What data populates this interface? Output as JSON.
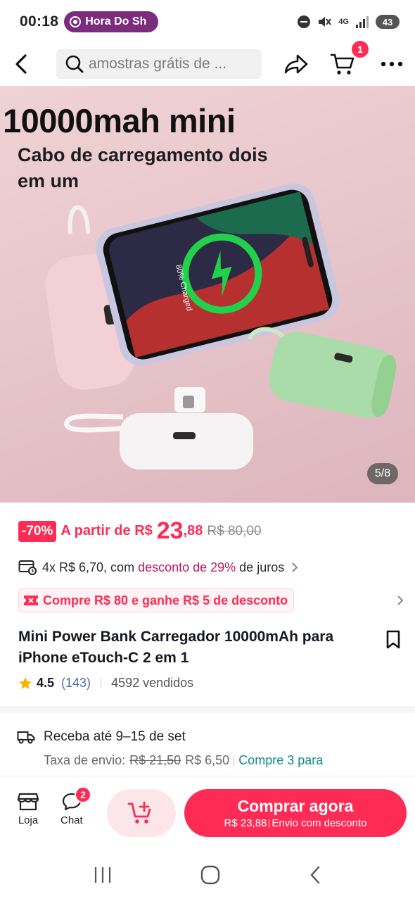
{
  "status_bar": {
    "time": "00:18",
    "live_pill": "Hora Do Sh",
    "network": "4G",
    "battery": "43"
  },
  "top_nav": {
    "search_placeholder": "amostras grátis de ...",
    "cart_count": "1"
  },
  "hero": {
    "title": "10000mah mini",
    "subtitle": "Cabo de carregamento dois em um",
    "phone_screen_text": "80% Charged",
    "counter": "5/8"
  },
  "price": {
    "discount": "-70%",
    "from_label": "A partir de R$",
    "value_int": "23",
    "value_dec": ",88",
    "old_price": "R$ 80,00"
  },
  "installment": {
    "prefix": "4x R$ 6,70, com",
    "highlight": "desconto de 29%",
    "suffix": "de juros"
  },
  "promo": {
    "label": "Compre R$ 80 e ganhe R$ 5 de desconto"
  },
  "product": {
    "title": "Mini Power Bank Carregador 10000mAh para iPhone eTouch-C 2 em 1",
    "rating": "4.5",
    "reviews": "(143)",
    "sold": "4592 vendidos"
  },
  "delivery": {
    "text": "Receba até 9–15 de set",
    "shipping_label": "Taxa de envio:",
    "shipping_old": "R$ 21,50",
    "shipping_new": "R$ 6,50",
    "shipping_promo": "Compre 3 para"
  },
  "bottom_bar": {
    "shop_label": "Loja",
    "chat_label": "Chat",
    "chat_badge": "2",
    "buy_label": "Comprar agora",
    "buy_price": "R$ 23,88",
    "buy_note": "Envio com desconto"
  },
  "colors": {
    "accent": "#fe2c55",
    "pill": "#7b2d7d"
  }
}
